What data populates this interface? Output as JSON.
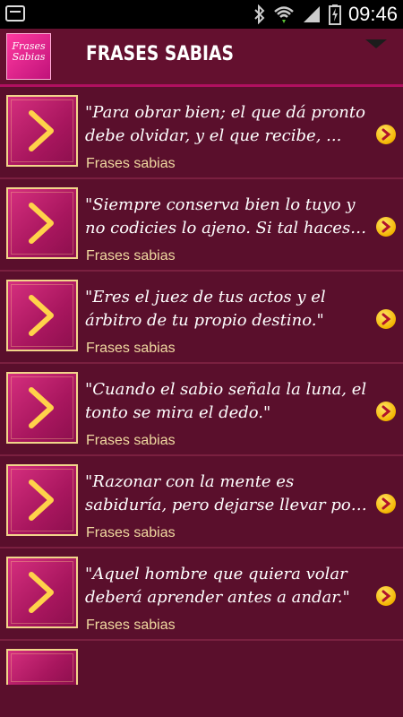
{
  "status_bar": {
    "time": "09:46"
  },
  "app": {
    "logo_line1": "Frases",
    "logo_line2": "Sabias",
    "title": "FRASES SABIAS"
  },
  "items": [
    {
      "quote": "\"Para obrar bien; el que dá pronto debe olvidar, y el que recibe, ...",
      "subtitle": "Frases sabias"
    },
    {
      "quote": "\"Siempre conserva bien lo tuyo y no codicies lo ajeno. Si tal haces…",
      "subtitle": "Frases sabias"
    },
    {
      "quote": "\"Eres el juez de tus actos y el árbitro de tu propio destino.\"",
      "subtitle": "Frases sabias"
    },
    {
      "quote": "\"Cuando el sabio señala la luna, el tonto se mira el dedo.\"",
      "subtitle": "Frases sabias"
    },
    {
      "quote": "\"Razonar con la mente es sabiduría, pero dejarse llevar po…",
      "subtitle": "Frases sabias"
    },
    {
      "quote": "\"Aquel hombre que quiera volar deberá aprender antes a andar.\"",
      "subtitle": "Frases sabias"
    }
  ],
  "icons": {
    "thumb": "chevron-right-icon",
    "go": "arrow-circle-icon",
    "overflow": "triangle-down-icon"
  },
  "colors": {
    "background": "#5a0f2c",
    "accent": "#b01060",
    "subtitle": "#f0d9a0"
  }
}
